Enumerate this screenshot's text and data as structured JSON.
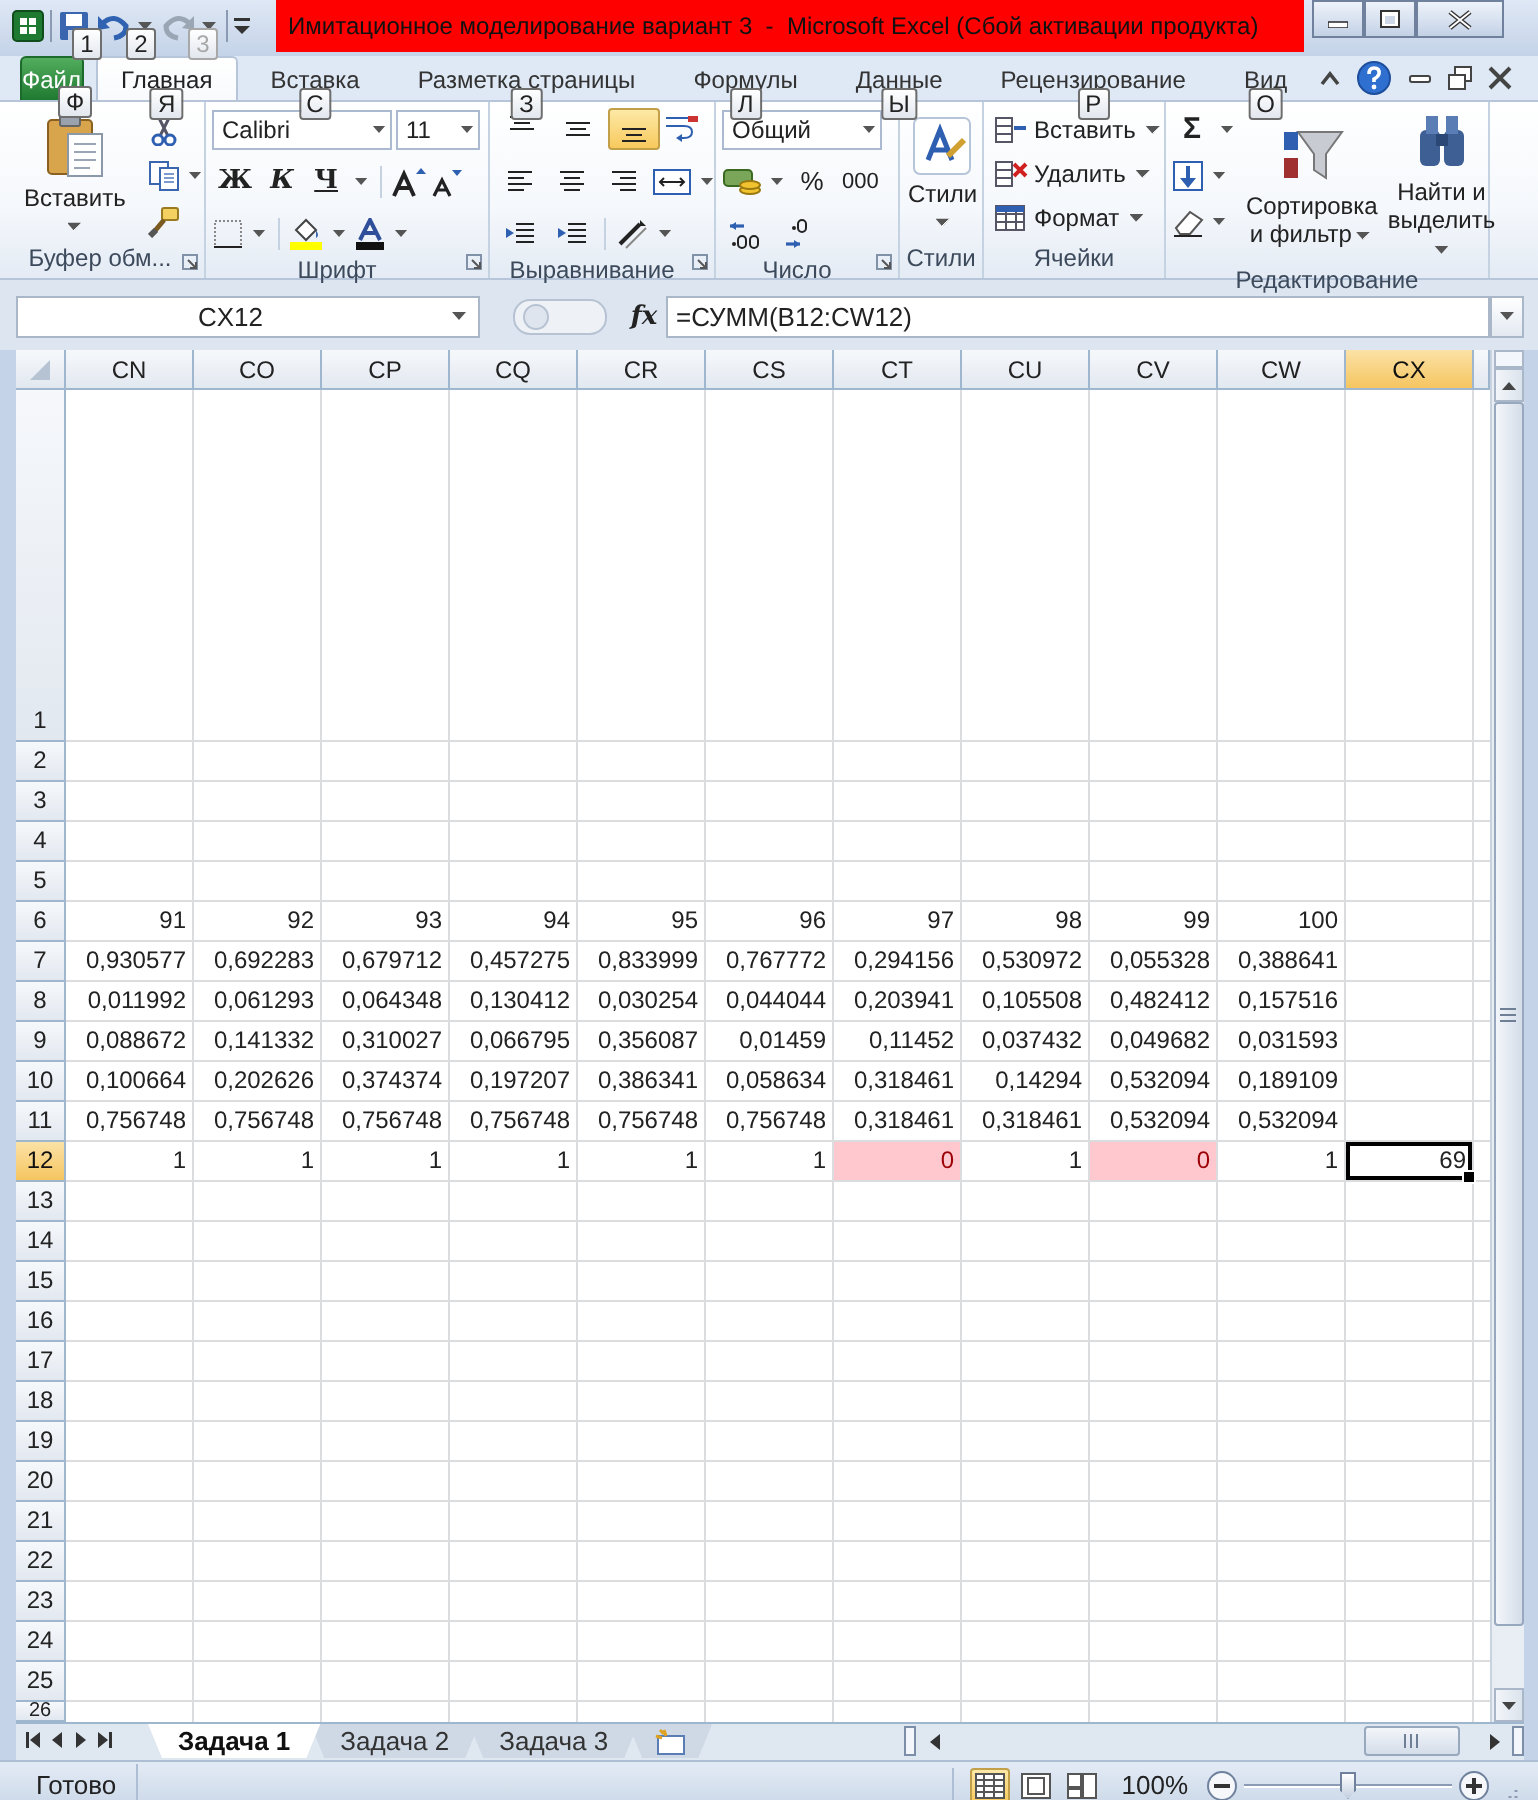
{
  "title_bar": {
    "title": "Имитационное моделирование вариант 3  -  Microsoft Excel (Сбой активации продукта)",
    "keytips": [
      {
        "label": "1",
        "disabled": false
      },
      {
        "label": "2",
        "disabled": false
      },
      {
        "label": "3",
        "disabled": true
      }
    ]
  },
  "ribbon_tabs": {
    "file": {
      "label": "Файл",
      "keytip": "Ф"
    },
    "tabs": [
      {
        "label": "Главная",
        "keytip": "Я",
        "selected": true
      },
      {
        "label": "Вставка",
        "keytip": "С",
        "selected": false
      },
      {
        "label": "Разметка страницы",
        "keytip": "З",
        "selected": false
      },
      {
        "label": "Формулы",
        "keytip": "Л",
        "selected": false
      },
      {
        "label": "Данные",
        "keytip": "Ы",
        "selected": false
      },
      {
        "label": "Рецензирование",
        "keytip": "Р",
        "selected": false
      },
      {
        "label": "Вид",
        "keytip": "О",
        "selected": false
      }
    ]
  },
  "ribbon": {
    "groups": [
      {
        "kind": "clipboard",
        "label": "Буфер обм...",
        "paste": "Вставить"
      },
      {
        "kind": "font",
        "label": "Шрифт",
        "font": "Calibri",
        "size": "11",
        "bold": "Ж",
        "italic": "К",
        "underline": "Ч"
      },
      {
        "kind": "alignment",
        "label": "Выравнивание",
        "vertical_align": [
          {
            "selected": false
          },
          {
            "selected": false
          },
          {
            "selected": true
          }
        ]
      },
      {
        "kind": "number",
        "label": "Число",
        "format": "Общий",
        "percent": "%",
        "thousands": "000"
      },
      {
        "kind": "styles",
        "label": "Стили",
        "button": "Стили"
      },
      {
        "kind": "cells",
        "label": "Ячейки",
        "buttons": [
          "Вставить",
          "Удалить",
          "Формат"
        ]
      },
      {
        "kind": "editing",
        "label": "Редактирование",
        "sum": "Σ",
        "sort": "Сортировка и фильтр",
        "find": "Найти и выделить"
      }
    ]
  },
  "formula_bar": {
    "name_box": "CX12",
    "function_label": "fx",
    "formula": "=СУММ(B12:CW12)"
  },
  "sheet": {
    "columns": [
      {
        "label": "CN",
        "selected": false
      },
      {
        "label": "CO",
        "selected": false
      },
      {
        "label": "CP",
        "selected": false
      },
      {
        "label": "CQ",
        "selected": false
      },
      {
        "label": "CR",
        "selected": false
      },
      {
        "label": "CS",
        "selected": false
      },
      {
        "label": "CT",
        "selected": false
      },
      {
        "label": "CU",
        "selected": false
      },
      {
        "label": "CV",
        "selected": false
      },
      {
        "label": "CW",
        "selected": false
      },
      {
        "label": "CX",
        "selected": true
      }
    ],
    "rows": [
      {
        "header": "1",
        "selected": false
      },
      {
        "header": "2",
        "selected": false
      },
      {
        "header": "3",
        "selected": false
      },
      {
        "header": "4",
        "selected": false
      },
      {
        "header": "5",
        "selected": false
      },
      {
        "header": "6",
        "selected": false,
        "cells": [
          "91",
          "92",
          "93",
          "94",
          "95",
          "96",
          "97",
          "98",
          "99",
          "100"
        ]
      },
      {
        "header": "7",
        "selected": false,
        "cells": [
          "0,930577",
          "0,692283",
          "0,679712",
          "0,457275",
          "0,833999",
          "0,767772",
          "0,294156",
          "0,530972",
          "0,055328",
          "0,388641"
        ]
      },
      {
        "header": "8",
        "selected": false,
        "cells": [
          "0,011992",
          "0,061293",
          "0,064348",
          "0,130412",
          "0,030254",
          "0,044044",
          "0,203941",
          "0,105508",
          "0,482412",
          "0,157516"
        ]
      },
      {
        "header": "9",
        "selected": false,
        "cells": [
          "0,088672",
          "0,141332",
          "0,310027",
          "0,066795",
          "0,356087",
          "0,01459",
          "0,11452",
          "0,037432",
          "0,049682",
          "0,031593"
        ]
      },
      {
        "header": "10",
        "selected": false,
        "cells": [
          "0,100664",
          "0,202626",
          "0,374374",
          "0,197207",
          "0,386341",
          "0,058634",
          "0,318461",
          "0,14294",
          "0,532094",
          "0,189109"
        ]
      },
      {
        "header": "11",
        "selected": false,
        "cells": [
          "0,756748",
          "0,756748",
          "0,756748",
          "0,756748",
          "0,756748",
          "0,756748",
          "0,318461",
          "0,318461",
          "0,532094",
          "0,532094"
        ]
      },
      {
        "header": "12",
        "selected": true,
        "cells": [
          {
            "value": "1",
            "flagged": false,
            "selected": false
          },
          {
            "value": "1",
            "flagged": false,
            "selected": false
          },
          {
            "value": "1",
            "flagged": false,
            "selected": false
          },
          {
            "value": "1",
            "flagged": false,
            "selected": false
          },
          {
            "value": "1",
            "flagged": false,
            "selected": false
          },
          {
            "value": "1",
            "flagged": false,
            "selected": false
          },
          {
            "value": "0",
            "flagged": true,
            "selected": false
          },
          {
            "value": "1",
            "flagged": false,
            "selected": false
          },
          {
            "value": "0",
            "flagged": true,
            "selected": false
          },
          {
            "value": "1",
            "flagged": false,
            "selected": false
          },
          {
            "value": "69",
            "flagged": false,
            "selected": true
          }
        ]
      },
      {
        "header": "13",
        "selected": false
      },
      {
        "header": "14",
        "selected": false
      },
      {
        "header": "15",
        "selected": false
      },
      {
        "header": "16",
        "selected": false
      },
      {
        "header": "17",
        "selected": false
      },
      {
        "header": "18",
        "selected": false
      },
      {
        "header": "19",
        "selected": false
      },
      {
        "header": "20",
        "selected": false
      },
      {
        "header": "21",
        "selected": false
      },
      {
        "header": "22",
        "selected": false
      },
      {
        "header": "23",
        "selected": false
      },
      {
        "header": "24",
        "selected": false
      },
      {
        "header": "25",
        "selected": false
      },
      {
        "header": "26",
        "selected": false
      }
    ]
  },
  "sheet_tabs": {
    "tabs": [
      {
        "label": "Задача 1",
        "selected": true
      },
      {
        "label": "Задача 2",
        "selected": false
      },
      {
        "label": "Задача 3",
        "selected": false
      }
    ]
  },
  "status_bar": {
    "status": "Готово",
    "views": [
      {
        "kind": "normal",
        "selected": true
      },
      {
        "kind": "page_layout",
        "selected": false
      },
      {
        "kind": "page_break",
        "selected": false
      }
    ],
    "zoom": "100%",
    "zoom_slider": {
      "level": 0.5
    }
  }
}
